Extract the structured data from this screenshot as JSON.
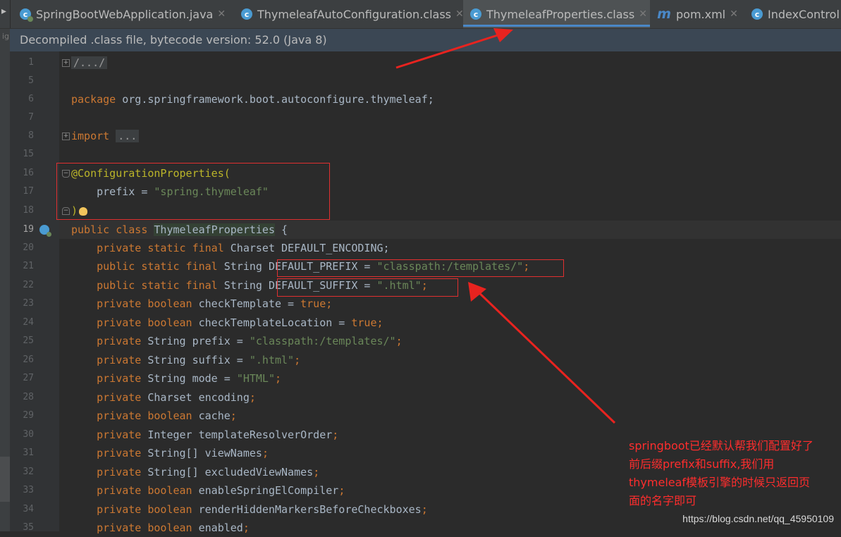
{
  "tabs": [
    {
      "label": "SpringBootWebApplication.java",
      "icon": "spring-class-icon",
      "active": false
    },
    {
      "label": "ThymeleafAutoConfiguration.class",
      "icon": "class-icon",
      "active": false
    },
    {
      "label": "ThymeleafProperties.class",
      "icon": "class-icon",
      "active": true
    },
    {
      "label": "pom.xml",
      "icon": "maven-icon",
      "active": false
    },
    {
      "label": "IndexControl",
      "icon": "class-icon",
      "active": false
    }
  ],
  "banner": "Decompiled .class file, bytecode version: 52.0 (Java 8)",
  "line_numbers": [
    "1",
    "5",
    "6",
    "7",
    "8",
    "15",
    "16",
    "17",
    "18",
    "19",
    "20",
    "21",
    "22",
    "23",
    "24",
    "25",
    "26",
    "27",
    "28",
    "29",
    "30",
    "31",
    "32",
    "33",
    "34",
    "35"
  ],
  "code": {
    "l1": "/.../",
    "l6_kw": "package",
    "l6_rest": " org.springframework.boot.autoconfigure.thymeleaf;",
    "l8_kw": "import",
    "l8_dots": "...",
    "l16": "@ConfigurationProperties(",
    "l17_a": "    prefix = ",
    "l17_b": "\"spring.thymeleaf\"",
    "l18": ")",
    "l19_kw": "public class ",
    "l19_cls": "ThymeleafProperties",
    "l19_rest": " {",
    "l20_kw": "    private static final ",
    "l20_rest": "Charset DEFAULT_ENCODING;",
    "l21_kw": "    public static final ",
    "l21_type": "String ",
    "l21_name": "DEFAULT_PREFIX = ",
    "l21_str": "\"classpath:/templates/\"",
    "l21_end": ";",
    "l22_kw": "    public static final ",
    "l22_type": "String ",
    "l22_name": "DEFAULT_SUFFIX = ",
    "l22_str": "\".html\"",
    "l22_end": ";",
    "l23_kw": "    private boolean ",
    "l23_name": "checkTemplate = ",
    "l23_val": "true",
    "l23_end": ";",
    "l24_kw": "    private boolean ",
    "l24_name": "checkTemplateLocation = ",
    "l24_val": "true",
    "l24_end": ";",
    "l25_kw": "    private ",
    "l25_rest": "String prefix = ",
    "l25_str": "\"classpath:/templates/\"",
    "l25_end": ";",
    "l26_kw": "    private ",
    "l26_rest": "String suffix = ",
    "l26_str": "\".html\"",
    "l26_end": ";",
    "l27_kw": "    private ",
    "l27_rest": "String mode = ",
    "l27_str": "\"HTML\"",
    "l27_end": ";",
    "l28_kw": "    private ",
    "l28_rest": "Charset encoding",
    "l28_end": ";",
    "l29_kw": "    private boolean ",
    "l29_rest": "cache",
    "l29_end": ";",
    "l30_kw": "    private ",
    "l30_rest": "Integer templateResolverOrder",
    "l30_end": ";",
    "l31_kw": "    private ",
    "l31_rest": "String[] viewNames",
    "l31_end": ";",
    "l32_kw": "    private ",
    "l32_rest": "String[] excludedViewNames",
    "l32_end": ";",
    "l33_kw": "    private boolean ",
    "l33_rest": "enableSpringElCompiler",
    "l33_end": ";",
    "l34_kw": "    private boolean ",
    "l34_rest": "renderHiddenMarkersBeforeCheckboxes",
    "l34_end": ";",
    "l35_kw": "    private boolean ",
    "l35_rest": "enabled",
    "l35_end": ";"
  },
  "annotation": {
    "lines": [
      "springboot已经默认帮我们配置好了",
      "前后缀prefix和suffix,我们用",
      "thymeleaf模板引擎的时候只返回页",
      "面的名字即可"
    ]
  },
  "watermark": "https://blog.csdn.net/qq_45950109",
  "colors": {
    "annotation_red": "#e03030",
    "keyword": "#cc7832",
    "string": "#6a8759",
    "annotation": "#bbb529"
  }
}
